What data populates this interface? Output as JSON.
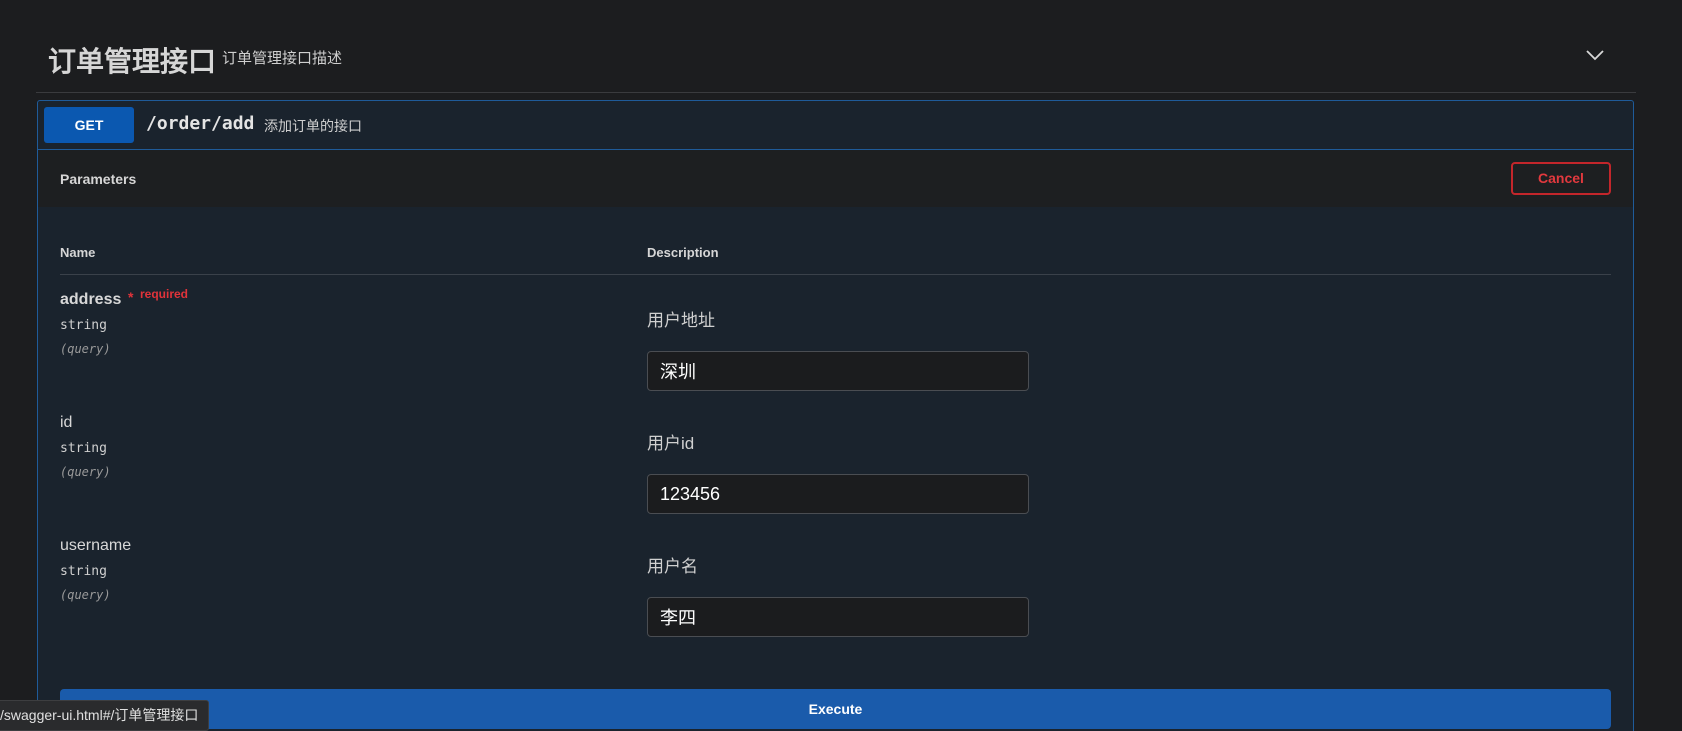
{
  "tag": {
    "title": "订单管理接口",
    "description": "订单管理接口描述"
  },
  "operation": {
    "method": "GET",
    "path": "/order/add",
    "summary": "添加订单的接口"
  },
  "parameters_section": {
    "title": "Parameters",
    "cancel_label": "Cancel",
    "col_name": "Name",
    "col_description": "Description"
  },
  "params": [
    {
      "name": "address",
      "required": true,
      "required_label": "required",
      "type": "string",
      "in": "(query)",
      "description": "用户地址",
      "value": "深圳"
    },
    {
      "name": "id",
      "required": false,
      "type": "string",
      "in": "(query)",
      "description": "用户id",
      "value": "123456"
    },
    {
      "name": "username",
      "required": false,
      "type": "string",
      "in": "(query)",
      "description": "用户名",
      "value": "李四"
    }
  ],
  "execute_label": "Execute",
  "status_bar": {
    "url": "/swagger-ui.html#/订单管理接口"
  },
  "colors": {
    "method_get": "#0b58b0",
    "cancel": "#c3262b",
    "execute": "#1a5bab",
    "required": "#e0333a"
  }
}
